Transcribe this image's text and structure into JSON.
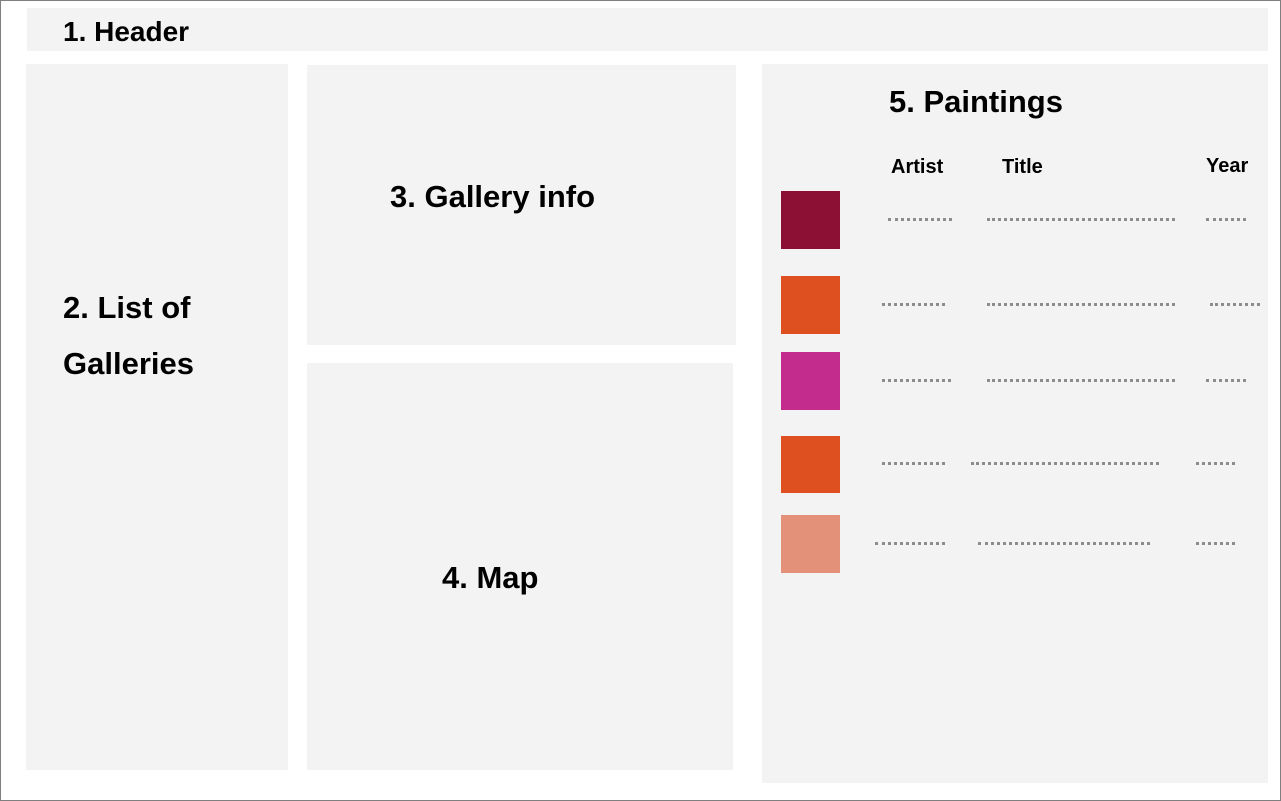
{
  "header": {
    "label": "1. Header"
  },
  "galleries": {
    "label": "2. List of Galleries"
  },
  "gallery_info": {
    "label": "3. Gallery info"
  },
  "map": {
    "label": "4. Map"
  },
  "paintings": {
    "label": "5. Paintings",
    "columns": [
      "Artist",
      "Title",
      "Year"
    ],
    "rows": [
      {
        "swatch_color": "#8c1034"
      },
      {
        "swatch_color": "#df5020"
      },
      {
        "swatch_color": "#c32c8c"
      },
      {
        "swatch_color": "#df5020"
      },
      {
        "swatch_color": "#e4917a"
      }
    ]
  }
}
